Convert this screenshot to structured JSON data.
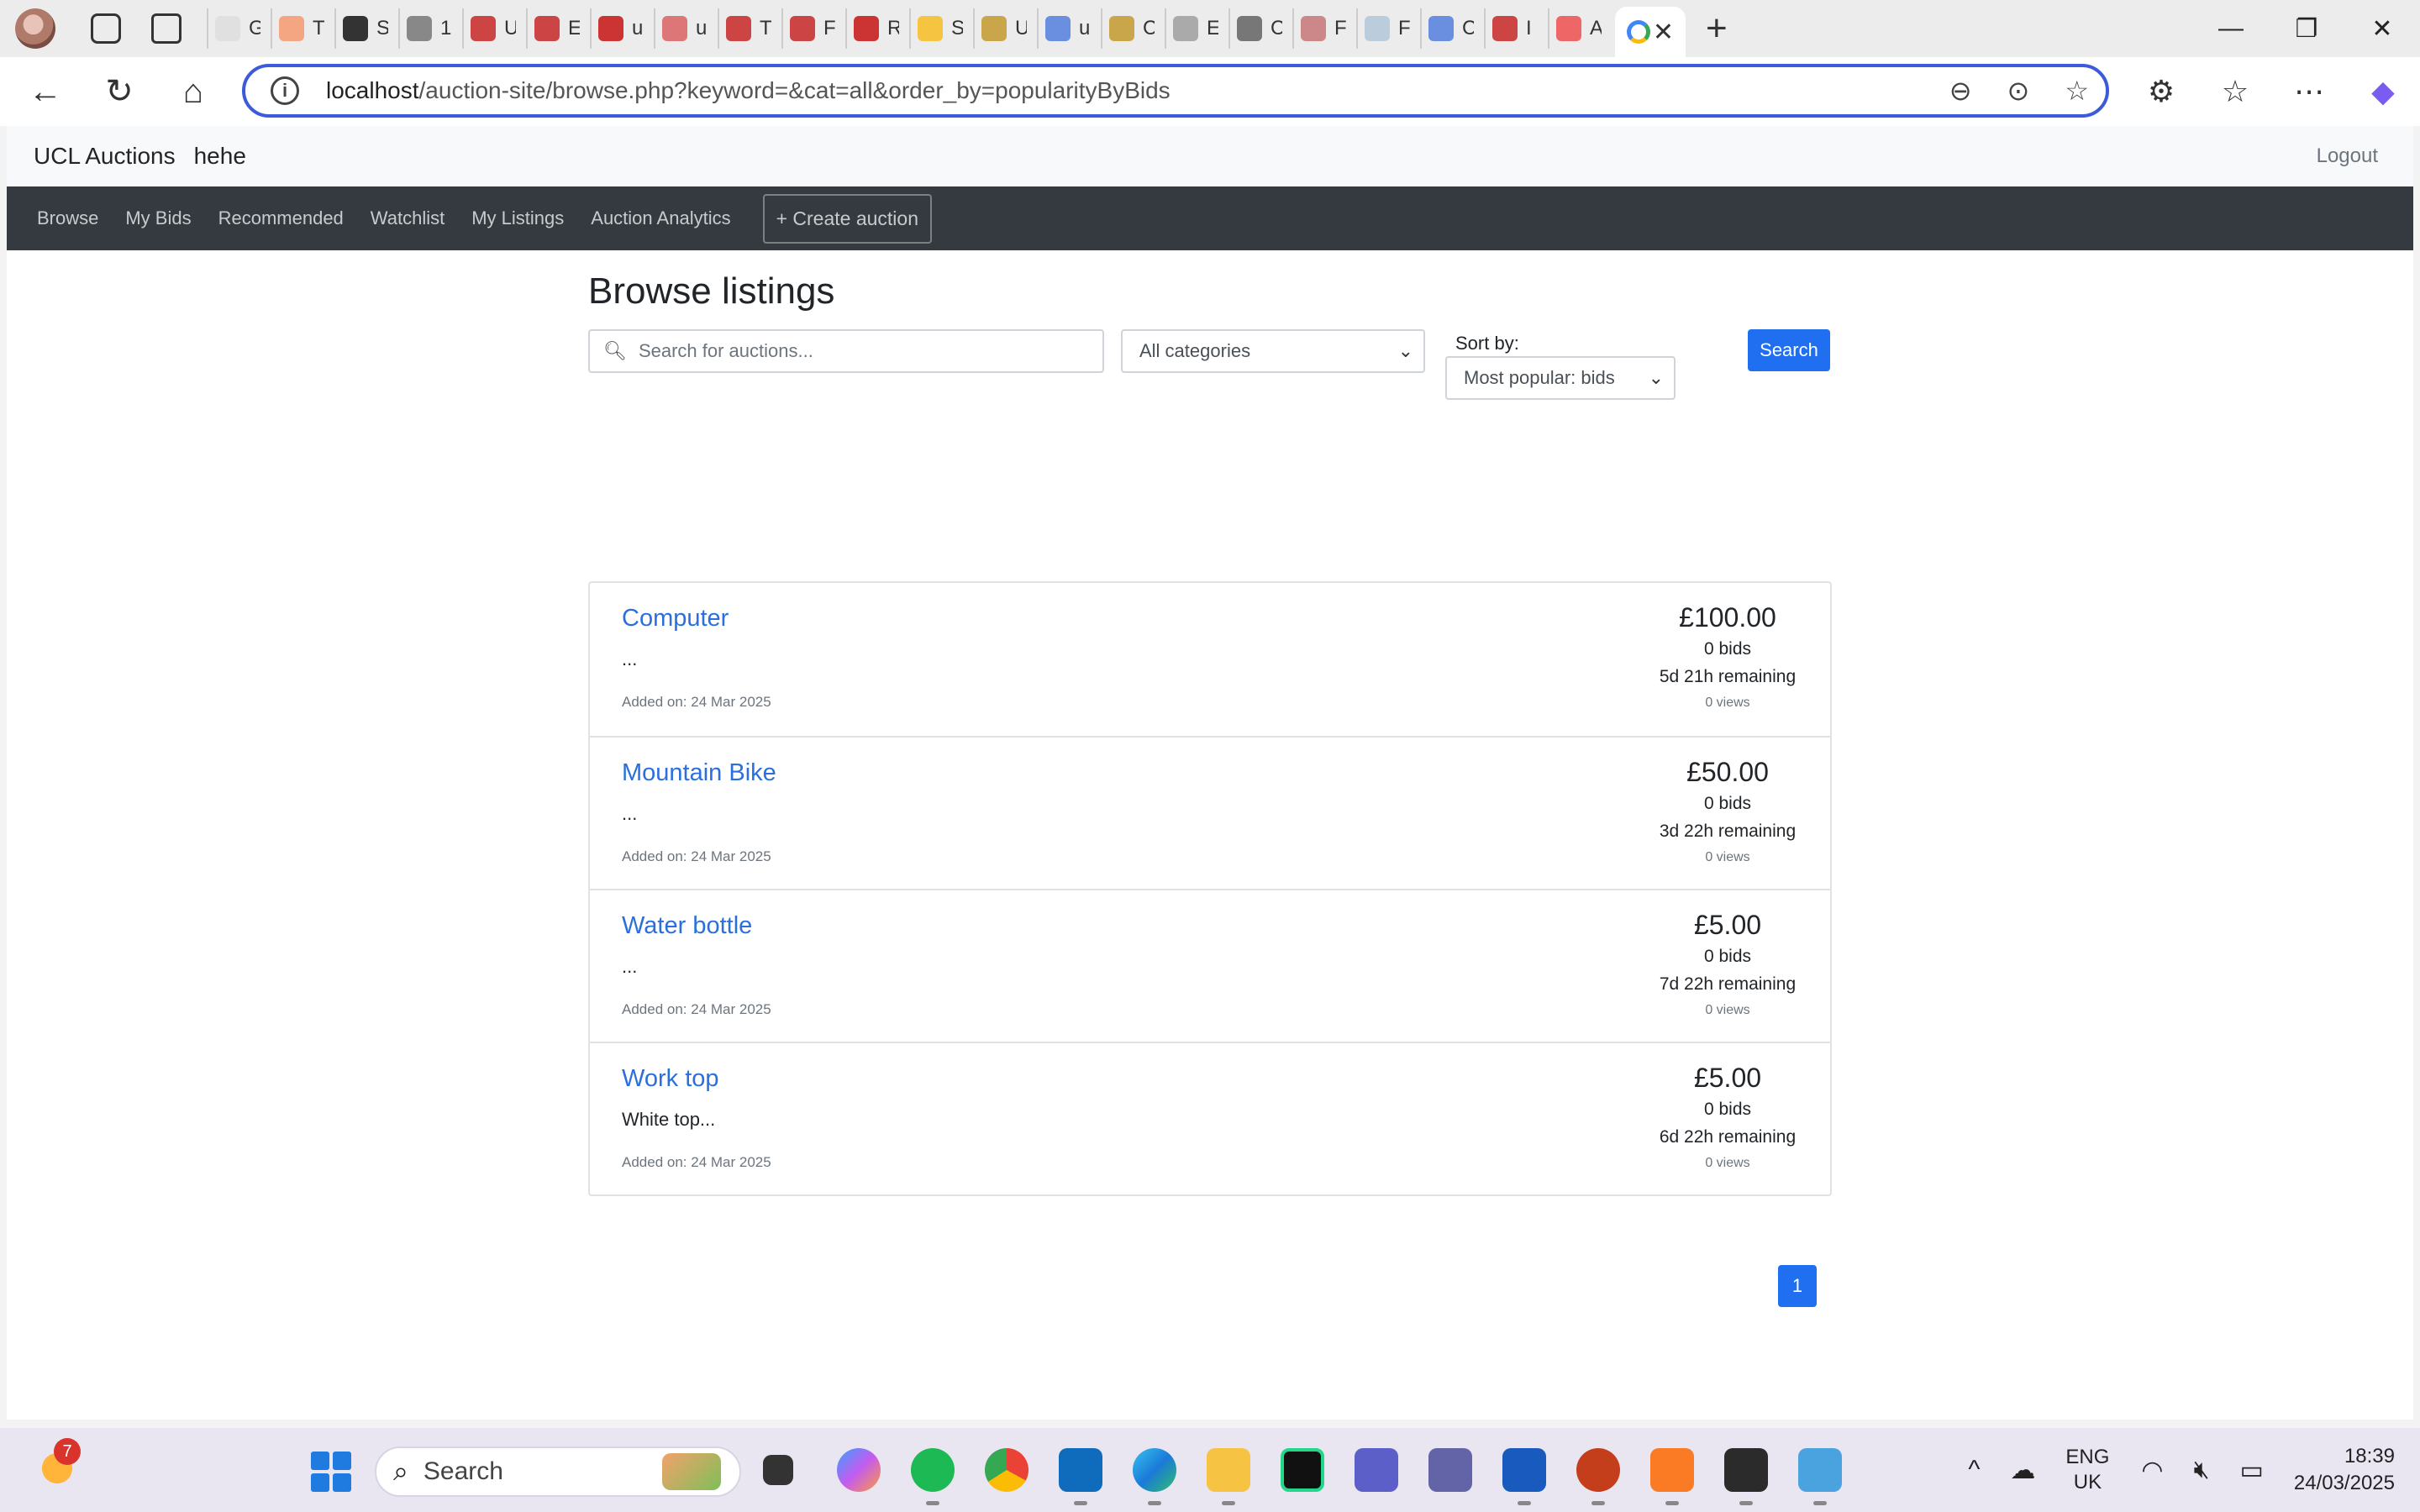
{
  "browser": {
    "tabs_partial_titles": [
      "G",
      "T",
      "S",
      "1",
      "U",
      "E",
      "u",
      "u",
      "T",
      "F",
      "R",
      "S",
      "U",
      "u",
      "C",
      "E",
      "C",
      "F",
      "F",
      "C",
      "I",
      "A"
    ],
    "url_host": "localhost",
    "url_path": "/auction-site/browse.php?keyword=&cat=all&order_by=popularityByBids"
  },
  "site": {
    "brand": "UCL Auctions",
    "username": "hehe",
    "logout": "Logout"
  },
  "nav": {
    "browse": "Browse",
    "my_bids": "My Bids",
    "recommended": "Recommended",
    "watchlist": "Watchlist",
    "my_listings": "My Listings",
    "analytics": "Auction Analytics",
    "create": "+ Create auction"
  },
  "browse": {
    "heading": "Browse listings",
    "search_placeholder": "Search for auctions...",
    "category_selected": "All categories",
    "sort_label": "Sort by:",
    "sort_selected": "Most popular: bids",
    "search_button": "Search"
  },
  "listings": [
    {
      "title": "Computer",
      "description": "...",
      "added": "Added on: 24 Mar 2025",
      "price": "£100.00",
      "bids": "0 bids",
      "remaining": "5d 21h remaining",
      "views": "0 views"
    },
    {
      "title": "Mountain Bike",
      "description": "...",
      "added": "Added on: 24 Mar 2025",
      "price": "£50.00",
      "bids": "0 bids",
      "remaining": "3d 22h remaining",
      "views": "0 views"
    },
    {
      "title": "Water bottle",
      "description": "...",
      "added": "Added on: 24 Mar 2025",
      "price": "£5.00",
      "bids": "0 bids",
      "remaining": "7d 22h remaining",
      "views": "0 views"
    },
    {
      "title": "Work top",
      "description": "White top...",
      "added": "Added on: 24 Mar 2025",
      "price": "£5.00",
      "bids": "0 bids",
      "remaining": "6d 22h remaining",
      "views": "0 views"
    }
  ],
  "pagination": {
    "current": "1"
  },
  "taskbar": {
    "weather_badge": "7",
    "search_label": "Search",
    "lang_line1": "ENG",
    "lang_line2": "UK",
    "time": "18:39",
    "date": "24/03/2025"
  },
  "colors": {
    "accent": "#1f6ff0",
    "link": "#2b6fdc",
    "nav_bg": "#343a40"
  }
}
